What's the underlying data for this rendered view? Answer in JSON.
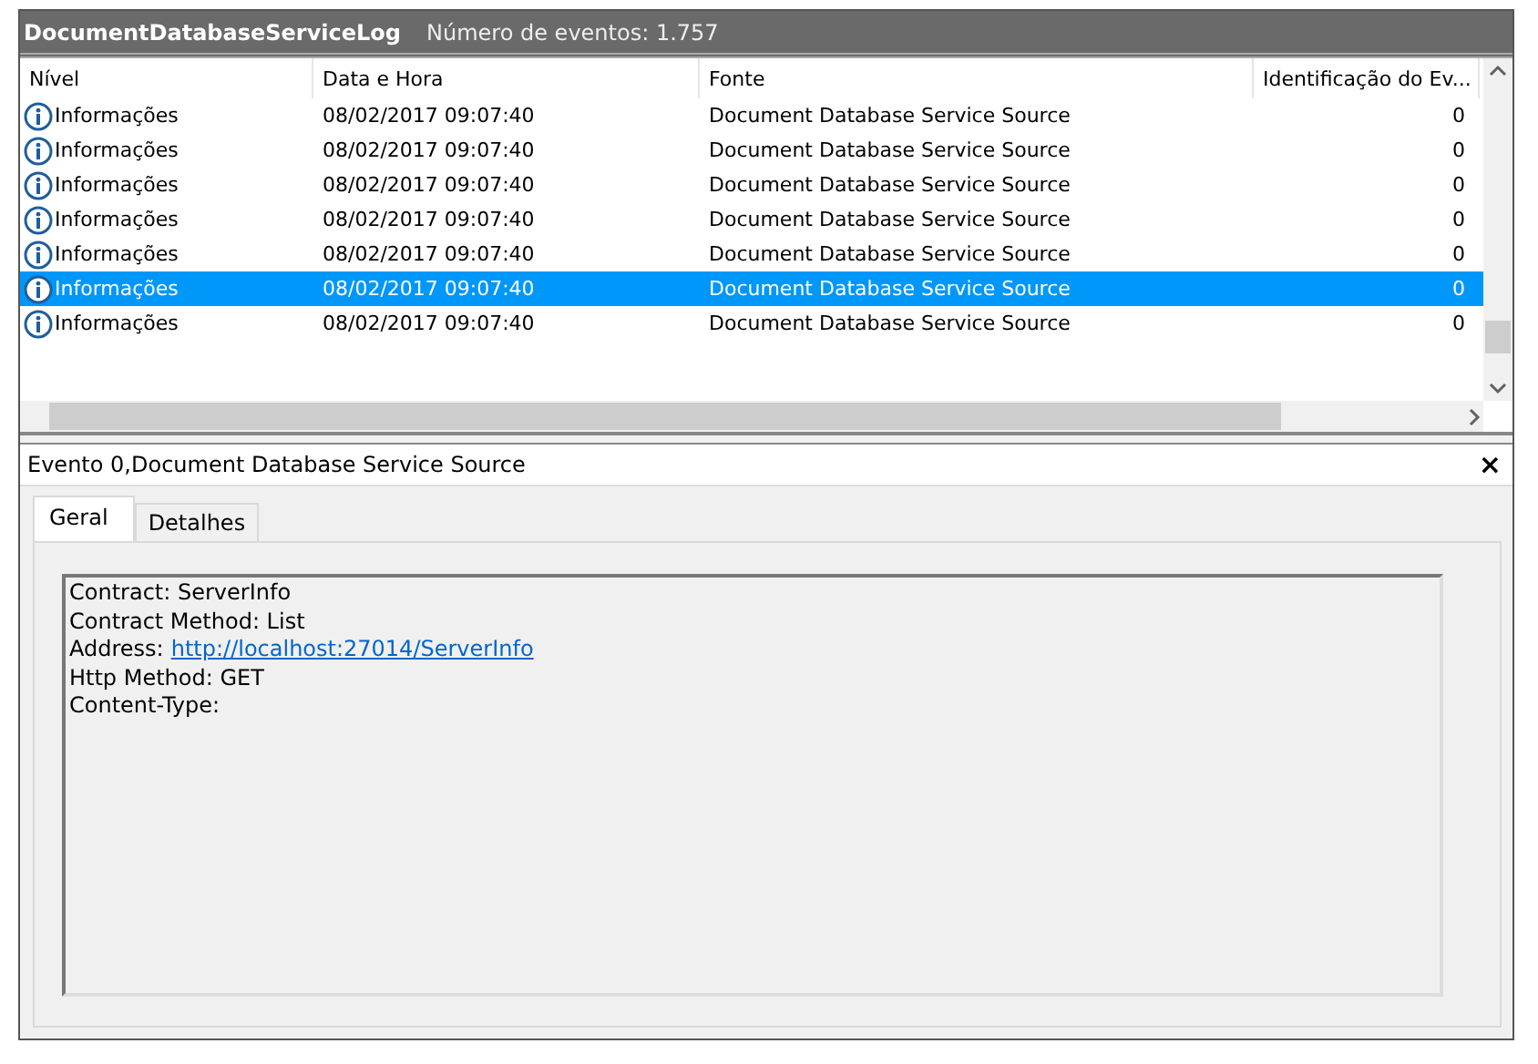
{
  "title_bar": {
    "log_name": "DocumentDatabaseServiceLog",
    "count": "Número de eventos: 1.757"
  },
  "table": {
    "columns": [
      "Nível",
      "Data e Hora",
      "Fonte",
      "Identificação do Ev..."
    ],
    "rows": [
      {
        "level": "Informações",
        "date": "08/02/2017 09:07:40",
        "source": "Document Database Service Source",
        "id": "0",
        "selected": false
      },
      {
        "level": "Informações",
        "date": "08/02/2017 09:07:40",
        "source": "Document Database Service Source",
        "id": "0",
        "selected": false
      },
      {
        "level": "Informações",
        "date": "08/02/2017 09:07:40",
        "source": "Document Database Service Source",
        "id": "0",
        "selected": false
      },
      {
        "level": "Informações",
        "date": "08/02/2017 09:07:40",
        "source": "Document Database Service Source",
        "id": "0",
        "selected": false
      },
      {
        "level": "Informações",
        "date": "08/02/2017 09:07:40",
        "source": "Document Database Service Source",
        "id": "0",
        "selected": false
      },
      {
        "level": "Informações",
        "date": "08/02/2017 09:07:40",
        "source": "Document Database Service Source",
        "id": "0",
        "selected": true
      },
      {
        "level": "Informações",
        "date": "08/02/2017 09:07:40",
        "source": "Document Database Service Source",
        "id": "0",
        "selected": false
      }
    ]
  },
  "detail": {
    "title": "Evento 0,Document Database Service Source",
    "close": "×",
    "tabs": [
      {
        "label": "Geral",
        "selected": true
      },
      {
        "label": "Detalhes",
        "selected": false
      }
    ],
    "lines": [
      {
        "text": "Contract: ServerInfo"
      },
      {
        "text": "Contract Method: List"
      },
      {
        "text": "Address:",
        "link": "http://localhost:27014/ServerInfo"
      },
      {
        "text": "Http Method: GET"
      },
      {
        "text": "Content-Type:"
      }
    ]
  }
}
